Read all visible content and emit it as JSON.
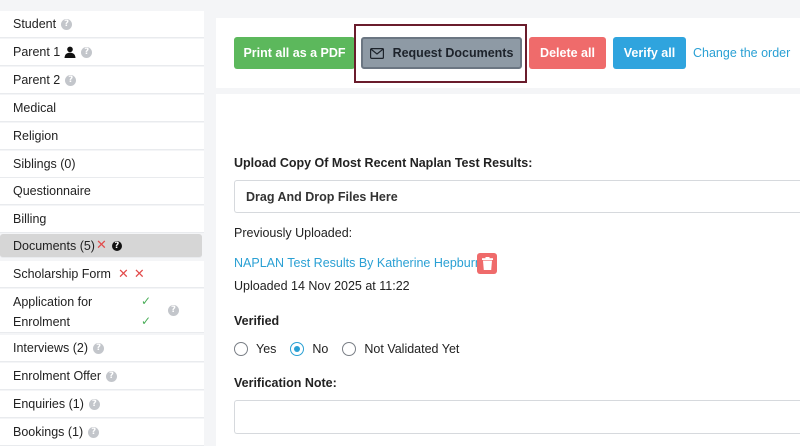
{
  "sidebar": {
    "items": [
      {
        "label": "Student"
      },
      {
        "label": "Parent 1"
      },
      {
        "label": "Parent 2"
      },
      {
        "label": "Medical"
      },
      {
        "label": "Religion"
      },
      {
        "label": "Siblings (0)"
      },
      {
        "label": "Questionnaire"
      },
      {
        "label": "Billing"
      },
      {
        "label": "Documents (5)"
      },
      {
        "label": "Scholarship Form"
      },
      {
        "label_line1": "Application for",
        "label_line2": "Enrolment"
      },
      {
        "label": "Interviews (2)"
      },
      {
        "label": "Enrolment Offer"
      },
      {
        "label": "Enquiries (1)"
      },
      {
        "label": "Bookings (1)"
      }
    ],
    "active_item": "Documents (5)"
  },
  "toolbar": {
    "print_pdf_label": "Print all as a PDF",
    "request_documents_label": "Request Documents",
    "delete_all_label": "Delete all",
    "verify_all_label": "Verify all",
    "change_order_label": "Change the order"
  },
  "form": {
    "upload_label": "Upload Copy Of Most Recent Naplan Test Results:",
    "dropzone_text": "Drag And Drop Files Here",
    "previously_uploaded_label": "Previously Uploaded:",
    "uploaded_file_name": "NAPLAN Test Results By Katherine Hepburn",
    "uploaded_date_text": "Uploaded 14 Nov 2025 at 11:22",
    "verified_label": "Verified",
    "verified_options": [
      "Yes",
      "No",
      "Not Validated Yet"
    ],
    "verified_selected": "No",
    "verification_note_label": "Verification Note:",
    "verification_note_value": ""
  },
  "colors": {
    "green": "#5cb85c",
    "gray_button": "#8e9aa5",
    "red": "#ef6b6b",
    "blue": "#2fa4de",
    "link": "#2aa0d4",
    "highlight_border": "#6a1c2c"
  }
}
